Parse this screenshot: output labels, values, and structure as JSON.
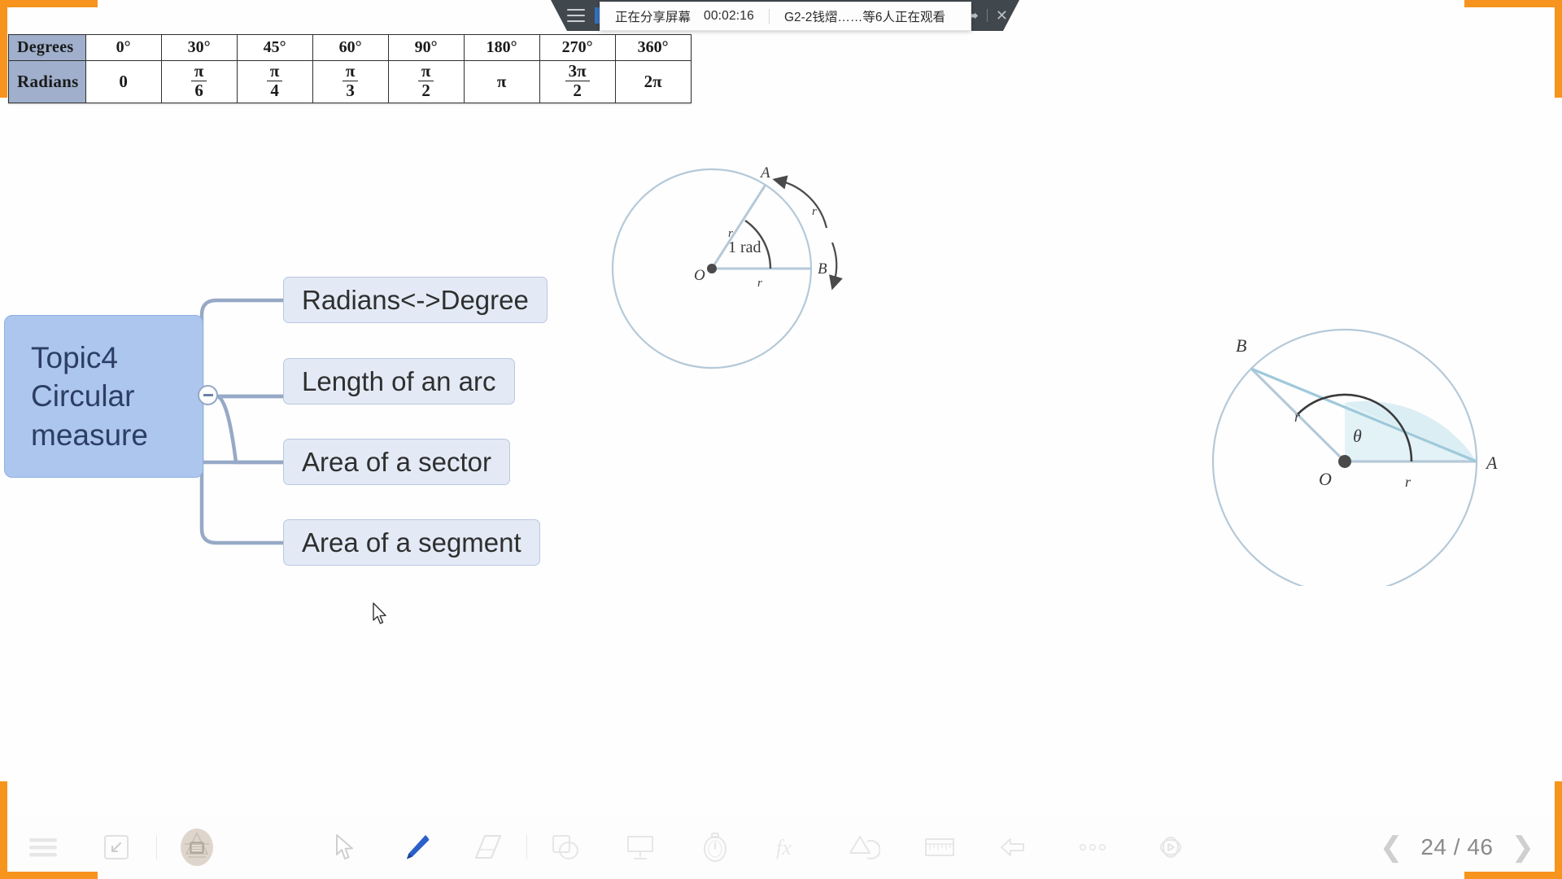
{
  "meeting_bar": {
    "menu_icon": "hamburger-icon",
    "close_icon": "close-icon",
    "share_icon": "share-icon"
  },
  "share_notice": {
    "status": "正在分享屏幕",
    "timer": "00:02:16",
    "viewers": "G2-2钱熠……等6人正在观看"
  },
  "reference_table": {
    "rows": [
      {
        "label": "Degrees",
        "cells": [
          "0°",
          "30°",
          "45°",
          "60°",
          "90°",
          "180°",
          "270°",
          "360°"
        ]
      },
      {
        "label": "Radians",
        "cells": [
          "0",
          "π/6",
          "π/4",
          "π/3",
          "π/2",
          "π",
          "3π/2",
          "2π"
        ]
      }
    ],
    "radians_fractions": [
      {
        "whole": "0"
      },
      {
        "num": "π",
        "den": "6"
      },
      {
        "num": "π",
        "den": "4"
      },
      {
        "num": "π",
        "den": "3"
      },
      {
        "num": "π",
        "den": "2"
      },
      {
        "whole": "π"
      },
      {
        "num": "3π",
        "den": "2"
      },
      {
        "whole": "2π"
      }
    ]
  },
  "mindmap": {
    "root": {
      "line1": "Topic4",
      "line2": "Circular",
      "line3": "measure"
    },
    "collapse_icon": "minus-circle-icon",
    "nodes": [
      {
        "label": "Radians<->Degree"
      },
      {
        "label": "Length of an arc"
      },
      {
        "label": "Area of a sector"
      },
      {
        "label": "Area of a segment"
      }
    ]
  },
  "figure_radian": {
    "center_label": "O",
    "point_a": "A",
    "point_b": "B",
    "angle_label": "1 rad",
    "radius_label_1": "r",
    "radius_label_2": "r",
    "arc_label": "r"
  },
  "figure_segment": {
    "center_label": "O",
    "point_a": "A",
    "point_b": "B",
    "angle_label": "θ",
    "radius_label_1": "r",
    "radius_label_2": "r"
  },
  "toolbar": {
    "tools": [
      {
        "name": "menu-lines-icon",
        "active": false
      },
      {
        "name": "minimize-icon",
        "active": false
      },
      {
        "name": "user-badge-icon",
        "active": false
      },
      {
        "name": "select-cursor-icon",
        "active": false
      },
      {
        "name": "pen-icon",
        "active": true
      },
      {
        "name": "eraser-icon",
        "active": false
      },
      {
        "name": "shapes-icon",
        "active": false
      },
      {
        "name": "whiteboard-icon",
        "active": false
      },
      {
        "name": "timer-icon",
        "active": false
      },
      {
        "name": "formula-icon",
        "active": false
      },
      {
        "name": "geometry-icon",
        "active": false
      },
      {
        "name": "ruler-icon",
        "active": false
      },
      {
        "name": "undo-icon",
        "active": false
      },
      {
        "name": "more-options-icon",
        "active": false
      },
      {
        "name": "laser-pointer-icon",
        "active": false
      }
    ],
    "page_prev_icon": "chevron-left-icon",
    "page_next_icon": "chevron-right-icon",
    "page_indicator": "24 / 46"
  },
  "colors": {
    "share_border": "#F7941E",
    "meeting_bar": "#41484d",
    "mindmap_root": "#adc6ee",
    "mindmap_node": "#e3eaf6",
    "pen_active": "#2b5fc9",
    "figure_stroke": "#a8c4d6"
  }
}
